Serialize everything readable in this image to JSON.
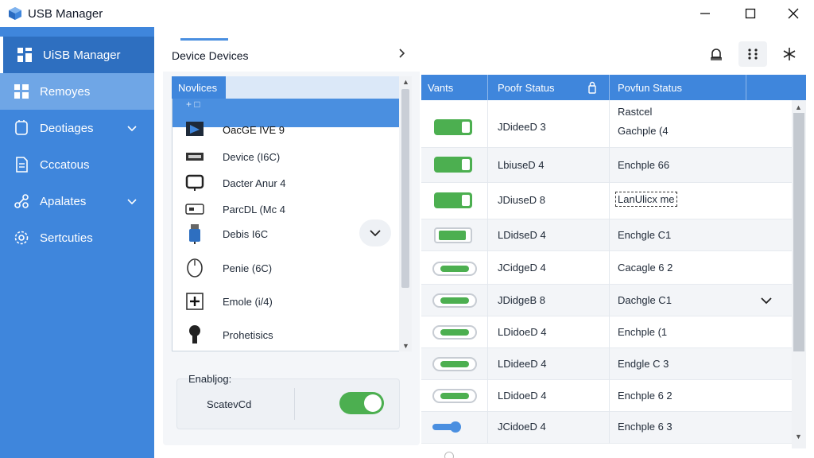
{
  "window": {
    "title": "USB Manager"
  },
  "sidebar": {
    "items": [
      {
        "label": "UiSB Manager",
        "icon": "dashboard-icon"
      },
      {
        "label": "Remoyes",
        "icon": "grid-icon"
      },
      {
        "label": "Deotiages",
        "icon": "device-icon"
      },
      {
        "label": "Cccatous",
        "icon": "document-icon"
      },
      {
        "label": "Apalates",
        "icon": "network-icon"
      },
      {
        "label": "Sertcuties",
        "icon": "gear-icon"
      }
    ]
  },
  "devices_panel": {
    "title": "Device Devices",
    "tab_label": "Novlices",
    "back_label": "+ □",
    "items": [
      {
        "label": "OacGE IVE 9",
        "icon": "monitor-icon"
      },
      {
        "label": "Device (I6C)",
        "icon": "card-reader-icon"
      },
      {
        "label": "Dacter Anur 4",
        "icon": "display-icon"
      },
      {
        "label": "ParcDL (Mc 4",
        "icon": "drive-icon"
      },
      {
        "label": "Debis I6C",
        "icon": "usb-stick-icon"
      },
      {
        "label": "Penie (6C)",
        "icon": "mouse-icon"
      },
      {
        "label": "Emole (i/4)",
        "icon": "plus-icon"
      },
      {
        "label": "Prohetisics",
        "icon": "joystick-icon"
      }
    ]
  },
  "enable_section": {
    "label": "Enabljog:",
    "sublabel": "ScatevCd",
    "toggle_on": true
  },
  "table": {
    "headers": [
      "Vants",
      "Poofr Status",
      "Povfun Status"
    ],
    "rows": [
      {
        "toggle": "on",
        "status": "JDideeD 3",
        "status2": "Gachple (4",
        "status2_top": "Rastcel"
      },
      {
        "toggle": "on",
        "status": "LbiuseD 4",
        "status2": "Enchple 66"
      },
      {
        "toggle": "on",
        "status": "JDiuseD 8",
        "status2": "LanUlicx me"
      },
      {
        "toggle": "outline",
        "status": "LDidseD 4",
        "status2": "Enchgle C1"
      },
      {
        "toggle": "pill",
        "status": "JCidgeD 4",
        "status2": "Cacagle 6 2"
      },
      {
        "toggle": "pill",
        "status": "JDidgeB 8",
        "status2": "Dachgle C1"
      },
      {
        "toggle": "pill",
        "status": "LDidoeD 4",
        "status2": "Enchple (1"
      },
      {
        "toggle": "pill",
        "status": "LDideeD 4",
        "status2": "Endgle C 3"
      },
      {
        "toggle": "pill",
        "status": "LDidoeD 4",
        "status2": "Enchple 6 2"
      },
      {
        "toggle": "slider",
        "status": "JCidoeD 4",
        "status2": "Enchple 6 3"
      }
    ]
  },
  "colors": {
    "accent": "#3f86dc",
    "toggle_on": "#4caf50"
  }
}
